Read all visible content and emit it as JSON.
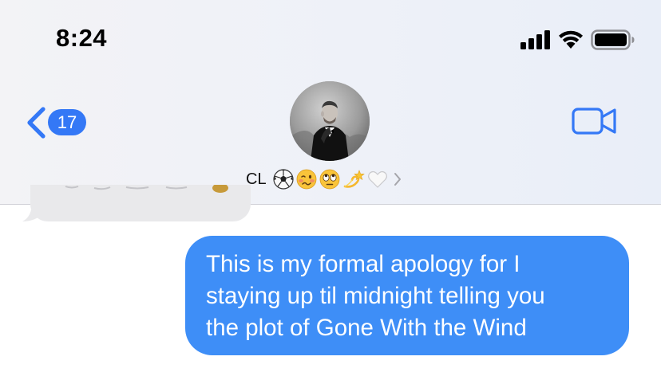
{
  "status_bar": {
    "time": "8:24",
    "icons": [
      "cellular-signal-icon",
      "wifi-icon",
      "battery-icon"
    ]
  },
  "nav": {
    "back_badge": "17",
    "back_icon": "chevron-left-icon",
    "video_icon": "video-camera-icon"
  },
  "contact": {
    "name": "CL",
    "emojis": [
      "soccer-ball-emoji",
      "woozy-face-emoji",
      "eye-roll-emoji",
      "dizzy-emoji",
      "white-heart-emoji"
    ],
    "chevron_icon": "chevron-right-icon"
  },
  "messages": {
    "outgoing": {
      "lines": [
        "This is my formal apology for I",
        "staying up til midnight telling you",
        "the plot of Gone With the Wind"
      ]
    }
  },
  "colors": {
    "accent": "#3478f6",
    "outgoing_bubble": "#3e8ef7",
    "incoming_bubble": "#e9e9eb",
    "header_bg": "#eef1f8"
  }
}
